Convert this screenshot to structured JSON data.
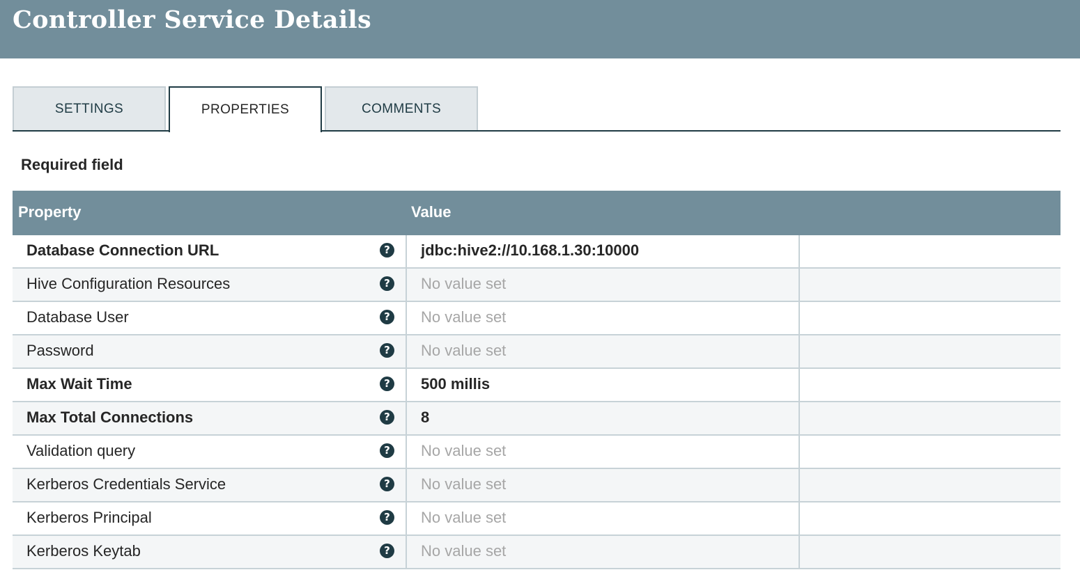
{
  "header": {
    "title": "Controller Service Details"
  },
  "tabs": [
    {
      "label": "SETTINGS",
      "active": false
    },
    {
      "label": "PROPERTIES",
      "active": true
    },
    {
      "label": "COMMENTS",
      "active": false
    }
  ],
  "required_label": "Required field",
  "table": {
    "columns": {
      "property": "Property",
      "value": "Value"
    },
    "rows": [
      {
        "property": "Database Connection URL",
        "required": true,
        "value": "jdbc:hive2://10.168.1.30:10000",
        "is_set": true
      },
      {
        "property": "Hive Configuration Resources",
        "required": false,
        "value": "No value set",
        "is_set": false
      },
      {
        "property": "Database User",
        "required": false,
        "value": "No value set",
        "is_set": false
      },
      {
        "property": "Password",
        "required": false,
        "value": "No value set",
        "is_set": false
      },
      {
        "property": "Max Wait Time",
        "required": true,
        "value": "500 millis",
        "is_set": true
      },
      {
        "property": "Max Total Connections",
        "required": true,
        "value": "8",
        "is_set": true
      },
      {
        "property": "Validation query",
        "required": false,
        "value": "No value set",
        "is_set": false
      },
      {
        "property": "Kerberos Credentials Service",
        "required": false,
        "value": "No value set",
        "is_set": false
      },
      {
        "property": "Kerberos Principal",
        "required": false,
        "value": "No value set",
        "is_set": false
      },
      {
        "property": "Kerberos Keytab",
        "required": false,
        "value": "No value set",
        "is_set": false
      }
    ],
    "help_icon": "question-circle-icon"
  },
  "colors": {
    "header_bg": "#728e9b",
    "accent_dark": "#1f3b44",
    "unset_text": "#a6a6a6"
  }
}
